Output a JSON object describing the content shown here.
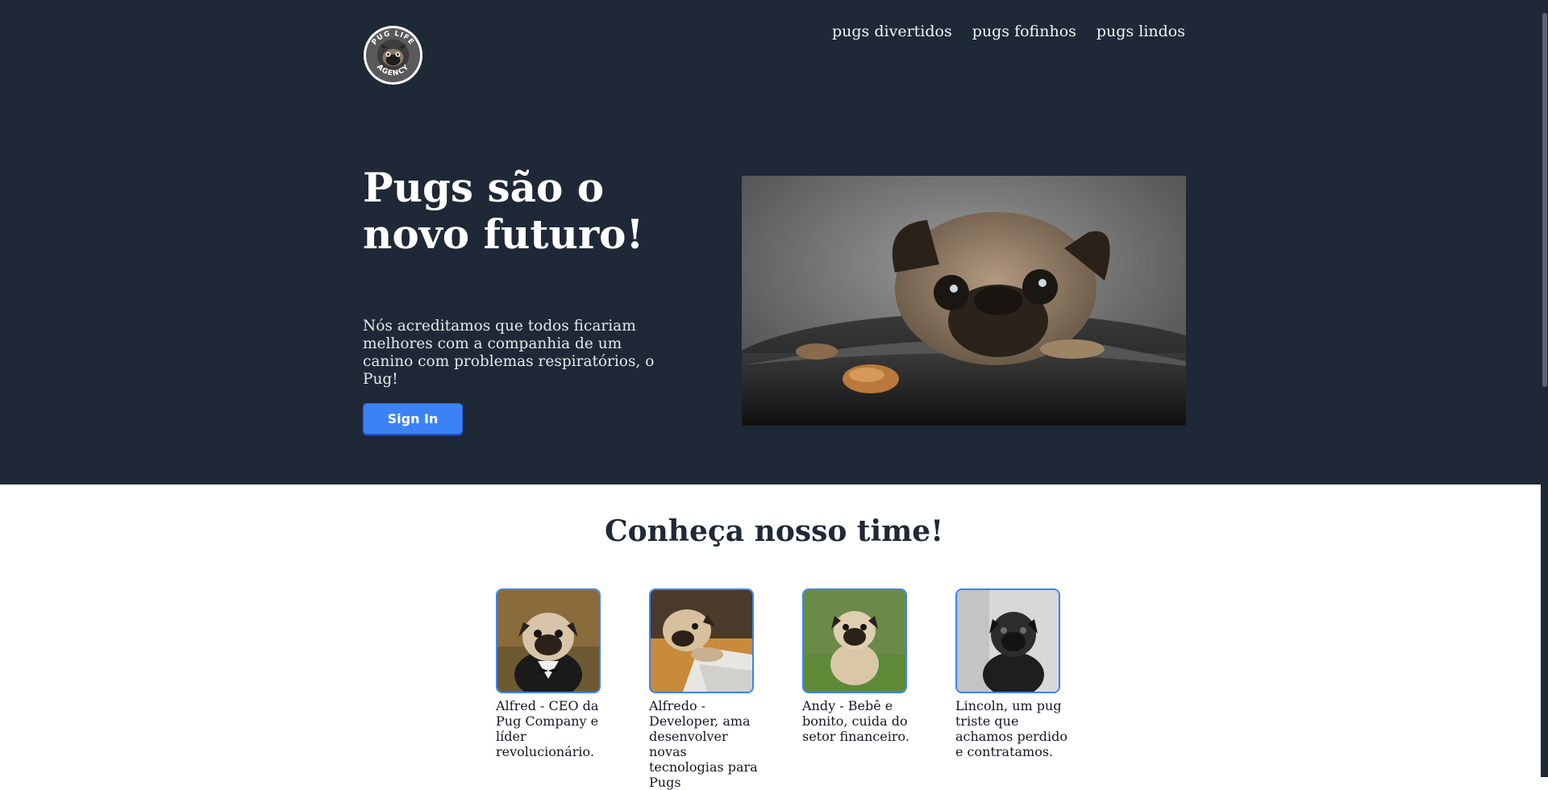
{
  "header": {
    "logo_text_top": "PUG LIFE",
    "logo_text_bottom": "AGENCY",
    "nav": [
      {
        "label": "pugs divertidos"
      },
      {
        "label": "pugs fofinhos"
      },
      {
        "label": "pugs lindos"
      }
    ]
  },
  "hero": {
    "title": "Pugs são o novo futuro!",
    "text": "Nós acreditamos que todos ficariam melhores com a companhia de um canino com problemas respiratórios, o Pug!",
    "button_label": "Sign In"
  },
  "team": {
    "title": "Conheça nosso time!",
    "members": [
      {
        "caption": "Alfred - CEO da Pug Company e líder revolucionário."
      },
      {
        "caption": "Alfredo - Developer, ama desenvolver novas tecnologias para Pugs"
      },
      {
        "caption": "Andy - Bebê e bonito, cuida do setor financeiro."
      },
      {
        "caption": "Lincoln, um pug triste que achamos perdido e contratamos."
      }
    ]
  },
  "colors": {
    "hero_bg": "#1f2837",
    "accent": "#3b82f6",
    "text_dark": "#1f2937"
  }
}
